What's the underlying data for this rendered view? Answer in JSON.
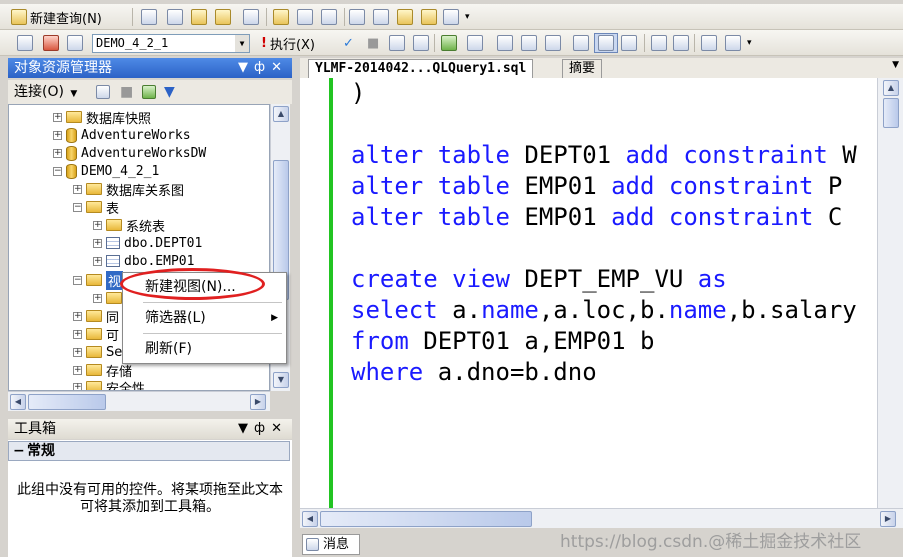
{
  "toolbar1": {
    "new_query_label": "新建查询(N)"
  },
  "toolbar2": {
    "database_selected": "DEMO_4_2_1",
    "execute_label": "执行(X)"
  },
  "object_explorer": {
    "title": "对象资源管理器",
    "connect_label": "连接(O)",
    "tree": {
      "snapshots": "数据库快照",
      "db1": "AdventureWorks",
      "db2": "AdventureWorksDW",
      "db3": "DEMO_4_2_1",
      "diagrams": "数据库关系图",
      "tables": "表",
      "system_tables": "系统表",
      "table1": "dbo.DEPT01",
      "table2": "dbo.EMP01",
      "views": "视",
      "synonyms": "同",
      "programmability": "可",
      "service_broker": "Se",
      "storage": "存储",
      "security": "安全性"
    }
  },
  "context_menu": {
    "new_view": "新建视图(N)...",
    "filter": "筛选器(L)",
    "refresh": "刷新(F)"
  },
  "toolbox": {
    "title": "工具箱",
    "category": "常规",
    "empty_message": "此组中没有可用的控件。将某项拖至此文本可将其添加到工具箱。"
  },
  "editor": {
    "tab_active": "YLMF-2014042...QLQuery1.sql",
    "tab_summary": "摘要",
    "code": {
      "l0": ")",
      "l1_kw1": "alter table",
      "l1_t1": " DEPT01 ",
      "l1_kw2": "add constraint",
      "l1_t2": " W",
      "l2_kw1": "alter table",
      "l2_t1": " EMP01 ",
      "l2_kw2": "add constraint",
      "l2_t2": " P",
      "l3_kw1": "alter table",
      "l3_t1": " EMP01 ",
      "l3_kw2": "add constraint",
      "l3_t2": " C",
      "l4_kw1": "create view",
      "l4_t1": " DEPT_EMP_VU ",
      "l4_kw2": "as",
      "l5_kw1": "select",
      "l5_t1": " a.",
      "l5_kw2": "name",
      "l5_t2": ",a.loc,b.",
      "l5_kw3": "name",
      "l5_t3": ",b.salary",
      "l6_kw1": "from",
      "l6_t1": " DEPT01 a,EMP01 b",
      "l7_kw1": "where",
      "l7_t1": " a.dno=b.dno"
    },
    "messages_tab": "消息"
  },
  "watermark": "https://blog.csdn.@稀土掘金技术社区"
}
